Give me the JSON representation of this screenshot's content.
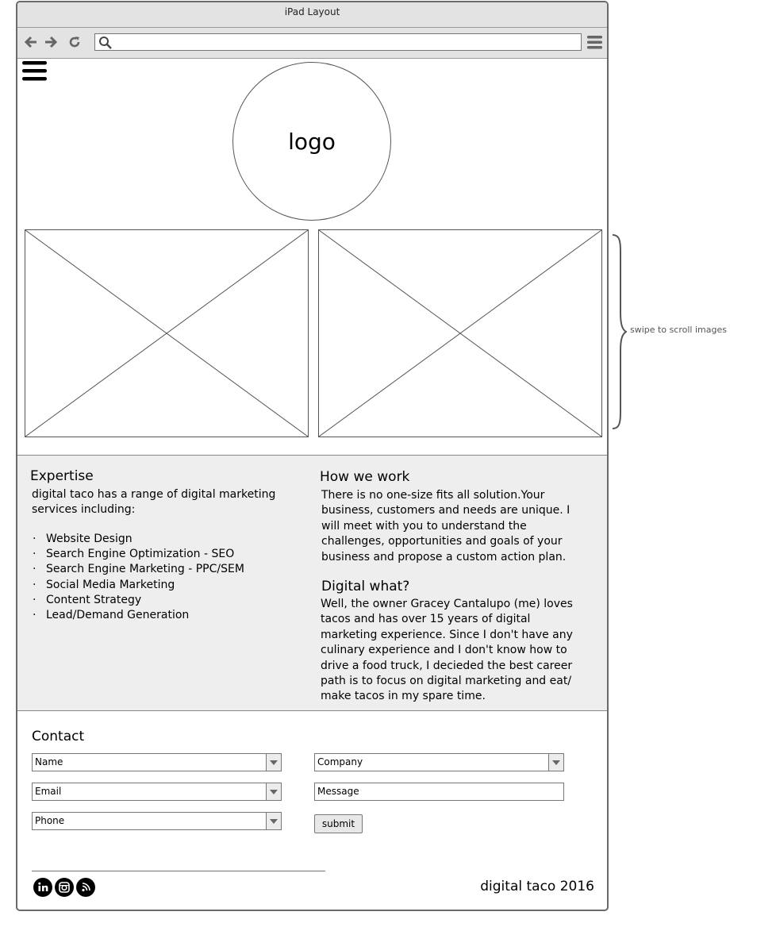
{
  "window": {
    "title": "iPad Layout"
  },
  "toolbar": {
    "url_value": "",
    "url_placeholder": ""
  },
  "header": {
    "logo_text": "logo"
  },
  "carousel": {
    "note": "swipe to scroll images"
  },
  "expertise": {
    "heading": "Expertise",
    "intro": "digital taco has a range of digital marketing services including:",
    "items": [
      "Website Design",
      "Search Engine Optimization - SEO",
      "Search Engine Marketing - PPC/SEM",
      "Social Media Marketing",
      "Content Strategy",
      "Lead/Demand Generation"
    ]
  },
  "how": {
    "heading": "How we work",
    "body": "There is no one-size fits all solution.Your business, customers and needs are unique. I will meet with you to understand the challenges, opportunities and goals of your business and propose a custom action plan."
  },
  "digital": {
    "heading": "Digital what?",
    "body": "Well, the owner Gracey Cantalupo (me) loves tacos and has over 15 years of digital marketing experience. Since I don't have any culinary experience and I don't know how to drive a food truck, I decieded the best career path is to focus on digital marketing and eat/ make tacos in my spare time."
  },
  "contact": {
    "heading": "Contact",
    "name": "Name",
    "email": "Email",
    "phone": "Phone",
    "company": "Company",
    "message": "Message",
    "submit": "submit"
  },
  "footer": {
    "text": "digital taco  2016",
    "social_icons": [
      "linkedin-icon",
      "instagram-icon",
      "blog-icon"
    ]
  }
}
